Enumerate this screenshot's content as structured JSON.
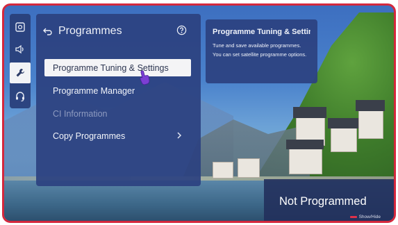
{
  "sidebar": {
    "items": [
      {
        "icon": "picture-settings-icon"
      },
      {
        "icon": "sound-icon"
      },
      {
        "icon": "wrench-icon",
        "active": true
      },
      {
        "icon": "headset-support-icon"
      }
    ]
  },
  "menu": {
    "title": "Programmes",
    "items": [
      {
        "label": "Programme Tuning & Settings",
        "state": "selected"
      },
      {
        "label": "Programme Manager",
        "state": "normal"
      },
      {
        "label": "CI Information",
        "state": "disabled"
      },
      {
        "label": "Copy Programmes",
        "state": "normal",
        "has_submenu": true
      }
    ]
  },
  "description": {
    "title": "Programme Tuning & Settin",
    "body": "Tune and save available programmes. You can set satellite programme options."
  },
  "status_overlay": {
    "title": "Not Programmed",
    "hint": "Show/Hide",
    "hint_key_color": "#e0314a"
  },
  "colors": {
    "frame_border": "#d4283d",
    "panel_bg": "#2c4280",
    "selected_bg": "#f4f4f6"
  }
}
